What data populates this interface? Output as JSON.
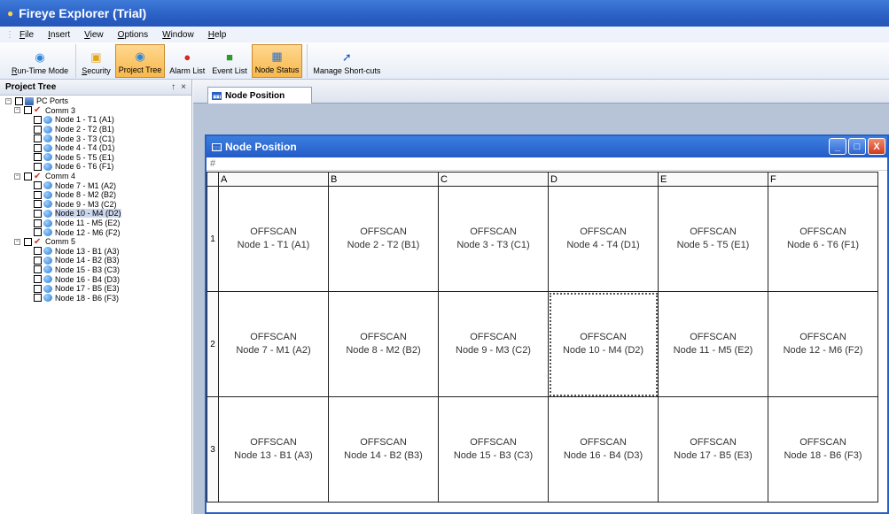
{
  "window": {
    "title": "Fireye Explorer (Trial)"
  },
  "menu": [
    "File",
    "Insert",
    "View",
    "Options",
    "Window",
    "Help"
  ],
  "toolbar": {
    "buttons": [
      {
        "label": "Run-Time Mode",
        "icon": "runtime-icon",
        "active": false
      },
      {
        "label": "Security",
        "icon": "lock-icon",
        "active": false
      },
      {
        "label": "Project Tree",
        "icon": "globe-icon",
        "active": true
      },
      {
        "label": "Alarm List",
        "icon": "alarm-icon",
        "active": false
      },
      {
        "label": "Event List",
        "icon": "event-icon",
        "active": false
      },
      {
        "label": "Node Status",
        "icon": "status-icon",
        "active": true
      },
      {
        "label": "Manage Short-cuts",
        "icon": "shortcut-arrow-icon",
        "active": false
      }
    ]
  },
  "project_tree": {
    "title": "Project Tree",
    "pin": "↑",
    "close": "×",
    "root": "PC Ports",
    "comms": [
      {
        "label": "Comm 3",
        "nodes": [
          "Node 1 - T1 (A1)",
          "Node 2 - T2 (B1)",
          "Node 3 - T3 (C1)",
          "Node 4 - T4 (D1)",
          "Node 5 - T5 (E1)",
          "Node 6 - T6 (F1)"
        ]
      },
      {
        "label": "Comm 4",
        "nodes": [
          "Node 7 - M1 (A2)",
          "Node 8 - M2 (B2)",
          "Node 9 - M3 (C2)",
          "Node 10 - M4 (D2)",
          "Node 11 - M5 (E2)",
          "Node 12 - M6 (F2)"
        ]
      },
      {
        "label": "Comm 5",
        "nodes": [
          "Node 13 - B1 (A3)",
          "Node 14 - B2 (B3)",
          "Node 15 - B3 (C3)",
          "Node 16 - B4 (D3)",
          "Node 17 - B5 (E3)",
          "Node 18 - B6 (F3)"
        ]
      }
    ],
    "selected": "Node 10 - M4 (D2)"
  },
  "doc_tab": {
    "label": "Node Position"
  },
  "node_window": {
    "title": "Node Position",
    "controls": [
      "_",
      "□",
      "X"
    ],
    "columns": [
      "A",
      "B",
      "C",
      "D",
      "E",
      "F"
    ],
    "rows": [
      {
        "label": "1",
        "cells": [
          {
            "status": "OFFSCAN",
            "node": "Node 1 - T1 (A1)"
          },
          {
            "status": "OFFSCAN",
            "node": "Node 2 - T2 (B1)"
          },
          {
            "status": "OFFSCAN",
            "node": "Node 3 - T3 (C1)"
          },
          {
            "status": "OFFSCAN",
            "node": "Node 4 - T4 (D1)"
          },
          {
            "status": "OFFSCAN",
            "node": "Node 5 - T5 (E1)"
          },
          {
            "status": "OFFSCAN",
            "node": "Node 6 - T6 (F1)"
          }
        ]
      },
      {
        "label": "2",
        "cells": [
          {
            "status": "OFFSCAN",
            "node": "Node 7 - M1 (A2)"
          },
          {
            "status": "OFFSCAN",
            "node": "Node 8 - M2 (B2)"
          },
          {
            "status": "OFFSCAN",
            "node": "Node 9 - M3 (C2)"
          },
          {
            "status": "OFFSCAN",
            "node": "Node 10 - M4 (D2)"
          },
          {
            "status": "OFFSCAN",
            "node": "Node 11 - M5 (E2)"
          },
          {
            "status": "OFFSCAN",
            "node": "Node 12 - M6 (F2)"
          }
        ]
      },
      {
        "label": "3",
        "cells": [
          {
            "status": "OFFSCAN",
            "node": "Node 13 - B1 (A3)"
          },
          {
            "status": "OFFSCAN",
            "node": "Node 14 - B2 (B3)"
          },
          {
            "status": "OFFSCAN",
            "node": "Node 15 - B3 (C3)"
          },
          {
            "status": "OFFSCAN",
            "node": "Node 16 - B4 (D3)"
          },
          {
            "status": "OFFSCAN",
            "node": "Node 17 - B5 (E3)"
          },
          {
            "status": "OFFSCAN",
            "node": "Node 18 - B6 (F3)"
          }
        ]
      }
    ],
    "focused_cell": "Node 10 - M4 (D2)"
  },
  "colors": {
    "title_bar": "#2a5fc4",
    "active_button": "#f7b84d",
    "mdi_background": "#b7c3d6"
  }
}
